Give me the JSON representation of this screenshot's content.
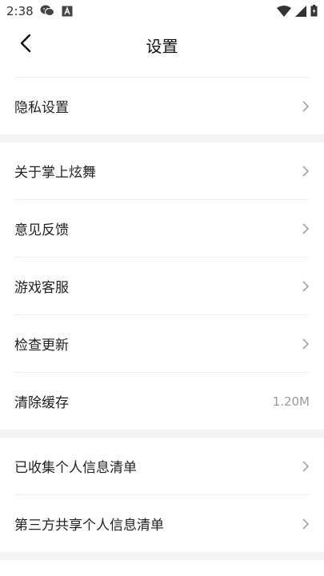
{
  "status_bar": {
    "time": "2:38",
    "left_icons": [
      "wechat-icon",
      "text-a-icon"
    ],
    "right_icons": [
      "wifi-icon",
      "signal-icon",
      "battery-icon"
    ]
  },
  "header": {
    "title": "设置",
    "back_icon": "back-arrow-icon"
  },
  "sections": [
    {
      "rows": [
        {
          "label": "隐私设置",
          "value": ""
        }
      ]
    },
    {
      "rows": [
        {
          "label": "关于掌上炫舞",
          "value": ""
        },
        {
          "label": "意见反馈",
          "value": ""
        },
        {
          "label": "游戏客服",
          "value": ""
        },
        {
          "label": "检查更新",
          "value": ""
        },
        {
          "label": "清除缓存",
          "value": "1.20M"
        }
      ]
    },
    {
      "rows": [
        {
          "label": "已收集个人信息清单",
          "value": ""
        },
        {
          "label": "第三方共享个人信息清单",
          "value": ""
        }
      ]
    }
  ],
  "colors": {
    "background": "#ffffff",
    "separator": "#f4f4f4",
    "text": "#222222",
    "secondary_text": "#999999"
  }
}
